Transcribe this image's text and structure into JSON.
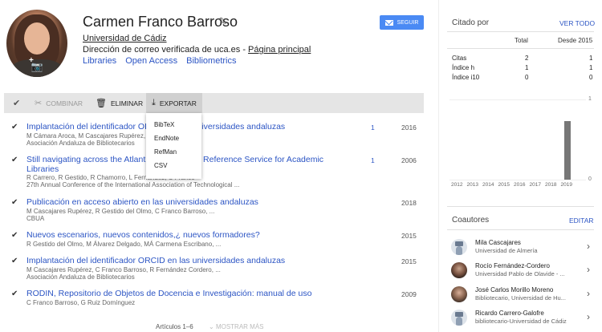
{
  "profile": {
    "name": "Carmen Franco Barroso",
    "affiliation": "Universidad de Cádiz",
    "email_text": "Dirección de correo verificada de uca.es - ",
    "homepage_link": "Página principal",
    "tags": [
      "Libraries",
      "Open Access",
      "Bibliometrics"
    ],
    "follow_label": "SEGUIR"
  },
  "toolbar": {
    "merge": "COMBINAR",
    "delete": "ELIMINAR",
    "export": "EXPORTAR"
  },
  "export_menu": [
    "BibTeX",
    "EndNote",
    "RefMan",
    "CSV"
  ],
  "articles": [
    {
      "title": "Implantación del identificador ORCID en las universidades andaluzas",
      "authors": "M Cámara Aroca, M Cascajares Rupérez, ...",
      "venue": "Asociación Andaluza de Bibliotecarios",
      "cited": "1",
      "year": "2016"
    },
    {
      "title": "Still navigating across the Atlantic: 30th Annual Reference Service for Academic",
      "title2": "Libraries",
      "authors": "R Carrero, R Gestido, R Chamorro, L Fernández, C Franco",
      "venue": "27th Annual Conference of the International Association of Technological ...",
      "cited": "1",
      "year": "2006"
    },
    {
      "title": "Publicación en acceso abierto en las universidades andaluzas",
      "authors": "M Cascajares Rupérez, R Gestido del Olmo, C Franco Barroso, ...",
      "venue": "CBUA",
      "cited": "",
      "year": "2018"
    },
    {
      "title": "Nuevos escenarios, nuevos contenidos,¿ nuevos formadores?",
      "authors": "R Gestido del Olmo, M Álvarez Delgado, MÁ Carmena Escribano, ...",
      "venue": "",
      "cited": "",
      "year": "2015"
    },
    {
      "title": "Implantación del identificador ORCID en las universidades andaluzas",
      "authors": "M Cascajares Rupérez, C Franco Barroso, R Fernández Cordero, ...",
      "venue": "Asociación Andaluza de Bibliotecarios",
      "cited": "",
      "year": "2015"
    },
    {
      "title": "RODIN, Repositorio de Objetos de Docencia e Investigación: manual de uso",
      "authors": "C Franco Barroso, G Ruiz Domínguez",
      "venue": "",
      "cited": "",
      "year": "2009"
    }
  ],
  "pager": {
    "range": "Artículos 1–6",
    "more": "MOSTRAR MÁS"
  },
  "cited_by": {
    "title": "Citado por",
    "view_all": "VER TODO",
    "col_total": "Total",
    "col_since": "Desde 2015",
    "rows": [
      {
        "label": "Citas",
        "total": "2",
        "since": "1"
      },
      {
        "label": "Índice h",
        "total": "1",
        "since": "1"
      },
      {
        "label": "Índice i10",
        "total": "0",
        "since": "0"
      }
    ]
  },
  "chart_data": {
    "type": "bar",
    "categories": [
      "2012",
      "2013",
      "2014",
      "2015",
      "2016",
      "2017",
      "2018",
      "2019"
    ],
    "values": [
      0,
      0,
      0,
      0,
      0,
      0,
      0,
      1
    ],
    "ylim": [
      0,
      1
    ],
    "yticks": [
      "1",
      "0"
    ],
    "grid": true,
    "bar_color": "#777777"
  },
  "coauthors": {
    "title": "Coautores",
    "edit": "EDITAR",
    "items": [
      {
        "name": "Mila Cascajares",
        "affil": "Universidad de Almería",
        "avatar": "placeholder"
      },
      {
        "name": "Rocío Fernández-Cordero",
        "affil": "Universidad Pablo de Olavide - ...",
        "avatar": "photo1"
      },
      {
        "name": "José Carlos Morillo Moreno",
        "affil": "Bibliotecario, Universidad de Hu...",
        "avatar": "photo2"
      },
      {
        "name": "Ricardo Carrero-Galofre",
        "affil": "bibliotecario-Universidad de Cádiz",
        "avatar": "placeholder"
      }
    ]
  },
  "colors": {
    "link": "#2c55c4",
    "follow_button": "#4a8af4",
    "toolbar_bg": "#e5e5e5"
  }
}
